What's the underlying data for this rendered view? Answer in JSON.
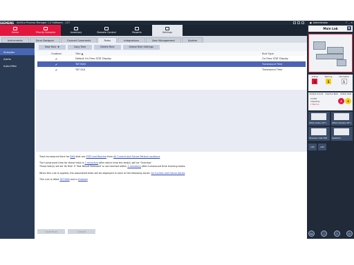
{
  "topbar": {
    "brand": "SIEMENS",
    "title": "Atellica Process Manager 1.0 Software - 127"
  },
  "modules": [
    {
      "label": "Home",
      "icon": "home-icon"
    },
    {
      "label": "Priority Samples",
      "icon": "samples-icon"
    },
    {
      "label": "Inventory",
      "icon": "inventory-icon"
    },
    {
      "label": "Remote Control",
      "icon": "remote-control-icon"
    },
    {
      "label": "Reports",
      "icon": "reports-icon"
    },
    {
      "label": "Settings",
      "icon": "settings-icon"
    }
  ],
  "subtabs": [
    "Instruments",
    "Zone Designer",
    "Canned Comments",
    "Rules",
    "Integrations",
    "User Management",
    "System"
  ],
  "leftnav": [
    "Samples",
    "Alerts",
    "Auto-filter"
  ],
  "toolbar": {
    "new_rule": "New Rule",
    "copy_rule": "Copy Rule",
    "delete_rule": "Delete Rule",
    "global_rule_settings": "Global Rule Settings"
  },
  "table": {
    "headers": {
      "enabled": "Enabled",
      "title": "Title",
      "rule_type": "Rule Type"
    },
    "rows": [
      {
        "enabled": "✔",
        "title": "Default On-Time STAT Display",
        "rule_type": "On-Time STAT Display"
      },
      {
        "enabled": "✔",
        "title": "TAT BUN",
        "rule_type": "Turnaround Time"
      },
      {
        "enabled": "✔",
        "title": "TAT GLU",
        "rule_type": "Turnaround Time"
      }
    ]
  },
  "description": {
    "l1_a": "Track turnaround time for ",
    "l1_b": "BUN",
    "l1_c": " that are ",
    "l1_d": "STAT and Routine",
    "l1_e": " from ",
    "l1_f": "All Current and Future Patient Locations",
    "l2_a": "The turnaround time for these tests is ",
    "l2_b": "2 minute(s)",
    "l2_c": " after which time the test(s) will be 'Overdue.'",
    "l3_a": "These test(s) will be 'At Risk' if 'Test Result Released' is not reached within ",
    "l3_b": "1 minute(s)",
    "l3_c": " after turnaround time tracking starts.",
    "l4_a": "When this rule is applied, the associated tests will be displayed in each of the following zones: ",
    "l4_b": "All Current and Future Zones",
    "l5_a": "This rule is titled ",
    "l5_b": "TAT BUN",
    "l5_c": " and is ",
    "l5_d": "Enabled"
  },
  "footer": {
    "save": "Save Rule",
    "cancel": "Cancel"
  },
  "right": {
    "user": "Administrator",
    "lab": "Main Lab",
    "alerts": [
      {
        "label": "Critical",
        "count": "1",
        "color": "#e3173e"
      },
      {
        "label": "Warning",
        "count": "1",
        "color": "#f5d000"
      },
      {
        "label": "Information",
        "count": "1",
        "color": "#ffffff"
      }
    ],
    "sample_counts_label": "Sample Counts",
    "overdue_label": "Overdue Tests",
    "atrisk_label": "At Risk Tests",
    "stat": "0 STAT",
    "routine": "2 Routine",
    "reruns": "1 Reruns",
    "overdue_count": "2",
    "atrisk_count": "2",
    "devices": [
      {
        "name": "ADVIA Centaur APT 1"
      },
      {
        "name": "ADVIA Chemistry APT 1"
      },
      {
        "name": "Dimension Vista 1500"
      },
      {
        "name": "VersaCell 1"
      }
    ],
    "small_tiles": [
      "LCM",
      "LCM"
    ],
    "bottom_icons": [
      "AA",
      "i",
      "?",
      "⏻"
    ]
  }
}
